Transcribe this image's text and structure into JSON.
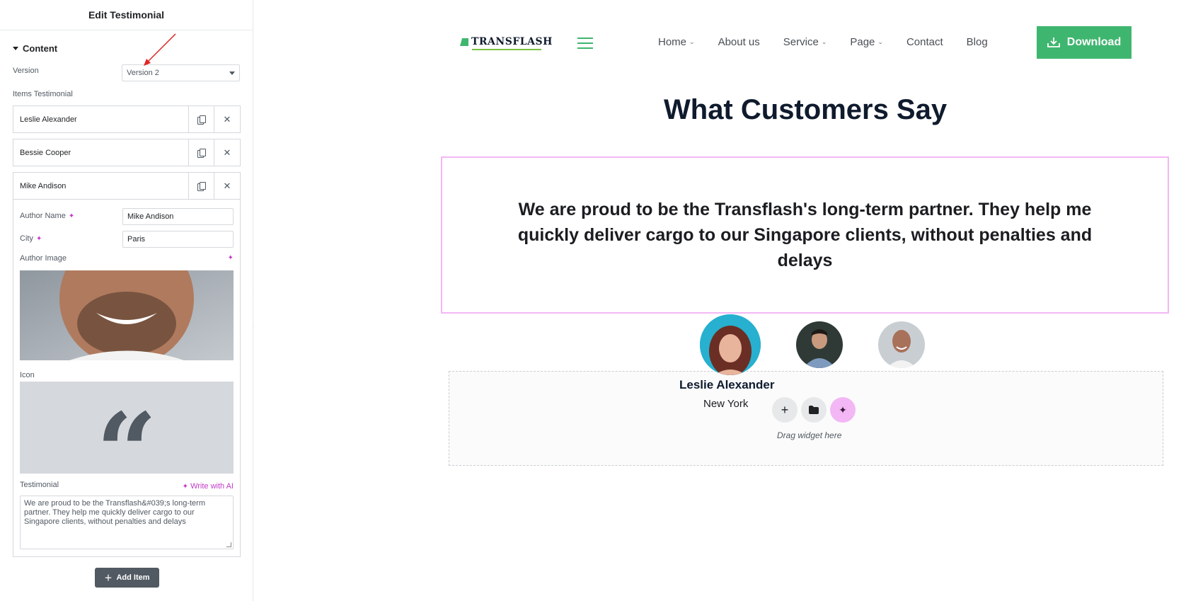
{
  "panel": {
    "title": "Edit Testimonial",
    "section": "Content",
    "version_label": "Version",
    "version_value": "Version 2",
    "items_label": "Items Testimonial",
    "items": [
      {
        "title": "Leslie Alexander"
      },
      {
        "title": "Bessie Cooper"
      },
      {
        "title": "Mike Andison"
      }
    ],
    "fields": {
      "author_name_label": "Author Name",
      "author_name_value": "Mike Andison",
      "city_label": "City",
      "city_value": "Paris",
      "author_image_label": "Author Image",
      "icon_label": "Icon",
      "testimonial_label": "Testimonial",
      "write_ai": "Write with AI",
      "testimonial_value": "We are proud to be the Transflash&#039;s long-term partner. They help me quickly deliver cargo to our Singapore clients, without penalties and delays"
    },
    "add_item": "Add Item"
  },
  "preview": {
    "logo": "TRANSFLASH",
    "nav": [
      {
        "label": "Home",
        "dropdown": true
      },
      {
        "label": "About us",
        "dropdown": false
      },
      {
        "label": "Service",
        "dropdown": true
      },
      {
        "label": "Page",
        "dropdown": true
      },
      {
        "label": "Contact",
        "dropdown": false
      },
      {
        "label": "Blog",
        "dropdown": false
      }
    ],
    "download": "Download",
    "heading": "What Customers Say",
    "quote": "We are proud to be the Transflash's long-term partner. They help me quickly deliver cargo to our Singapore clients, without penalties and delays",
    "author_name": "Leslie Alexander",
    "author_city": "New York",
    "drop_hint": "Drag widget here"
  },
  "colors": {
    "brand_green": "#3fb66f",
    "ai_magenta": "#c13ac7",
    "selection_pink": "#f3b7f5",
    "panel_dark": "#515962"
  }
}
